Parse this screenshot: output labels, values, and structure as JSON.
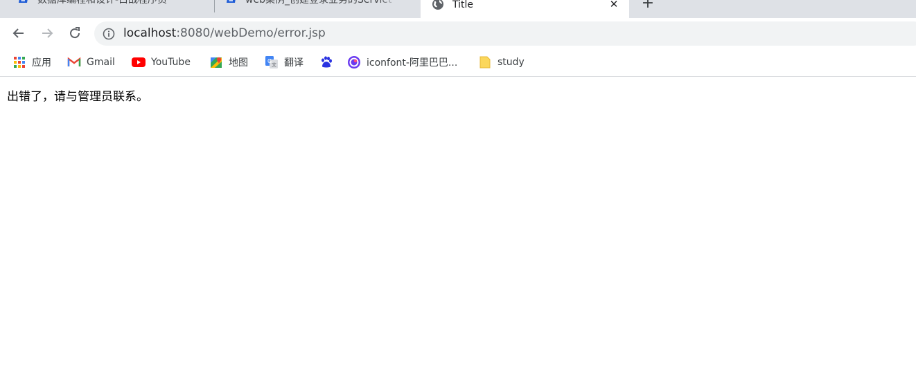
{
  "browser": {
    "tabs": [
      {
        "title": "数据库编程和设计-白战程序员",
        "favicon": "csdn-icon"
      },
      {
        "title": "web案例_创建登录业务的Servlet",
        "favicon": "csdn-icon"
      },
      {
        "title": "Title",
        "favicon": "globe-icon",
        "active": true
      }
    ],
    "close_glyph": "✕",
    "new_tab_glyph": "+",
    "address": {
      "host": "localhost",
      "path": ":8080/webDemo/error.jsp"
    },
    "bookmarks": [
      {
        "label": "应用",
        "icon": "apps-grid-icon"
      },
      {
        "label": "Gmail",
        "icon": "gmail-icon"
      },
      {
        "label": "YouTube",
        "icon": "youtube-icon"
      },
      {
        "label": "地图",
        "icon": "maps-icon"
      },
      {
        "label": "翻译",
        "icon": "translate-icon"
      },
      {
        "label": "",
        "icon": "baidu-icon"
      },
      {
        "label": "iconfont-阿里巴巴...",
        "icon": "iconfont-icon"
      },
      {
        "label": "study",
        "icon": "folder-icon"
      }
    ]
  },
  "page": {
    "message": "出错了，请与管理员联系。"
  },
  "colors": {
    "tabstrip": "#dee1e6",
    "omnibox": "#f1f3f4",
    "csdn_blue": "#1e5cd6",
    "youtube_red": "#ff0000",
    "folder_yellow": "#fbd75b"
  }
}
